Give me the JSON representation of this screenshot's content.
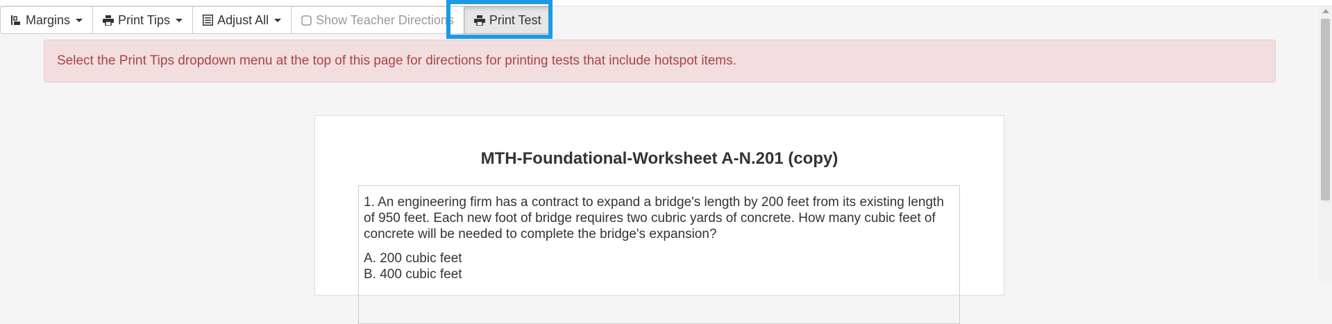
{
  "toolbar": {
    "margins_label": "Margins",
    "print_tips_label": "Print Tips",
    "adjust_all_label": "Adjust All",
    "show_teacher_directions_label": "Show Teacher Directions",
    "print_test_label": "Print Test"
  },
  "alert": {
    "text": "Select the Print Tips dropdown menu at the top of this page for directions for printing tests that include hotspot items."
  },
  "paper": {
    "title": "MTH-Foundational-Worksheet A-N.201 (copy)",
    "question": {
      "stem": "1. An engineering firm has a contract to expand a bridge's length by 200 feet from its existing length of 950 feet.  Each new foot of bridge requires two cubric yards of concrete.  How many cubic feet of concrete will be needed to complete the bridge's expansion?",
      "choices": [
        "A. 200 cubic feet",
        "B. 400 cubic feet"
      ]
    }
  },
  "colors": {
    "alert_bg": "#f2dede",
    "alert_text": "#a94442",
    "highlight": "#1a9be3"
  },
  "icons": [
    "margins-icon",
    "printer-icon",
    "list-icon",
    "checkbox-icon",
    "printer-icon"
  ]
}
